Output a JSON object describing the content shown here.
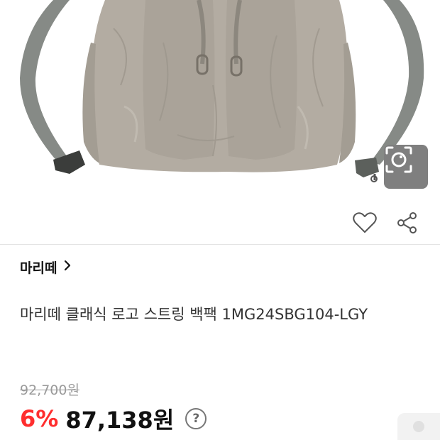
{
  "product": {
    "brand": "마리떼",
    "title": "마리떼 클래식 로고 스트링 백팩 1MG24SBG104-LGY",
    "original_price": "92,700원",
    "discount": "6%",
    "sale_price": "87,138원"
  },
  "icons": {
    "lens": "camera-lens-icon",
    "wishlist": "heart-icon",
    "share": "share-icon",
    "brand_chevron": "chevron-right-icon",
    "help": "question-icon"
  },
  "colors": {
    "discount": "#ff2e2e",
    "price": "#111111",
    "strike_price": "#9a9a9a",
    "bag_body": "#b3aca2",
    "strap": "#868a86"
  },
  "help_glyph": "?"
}
